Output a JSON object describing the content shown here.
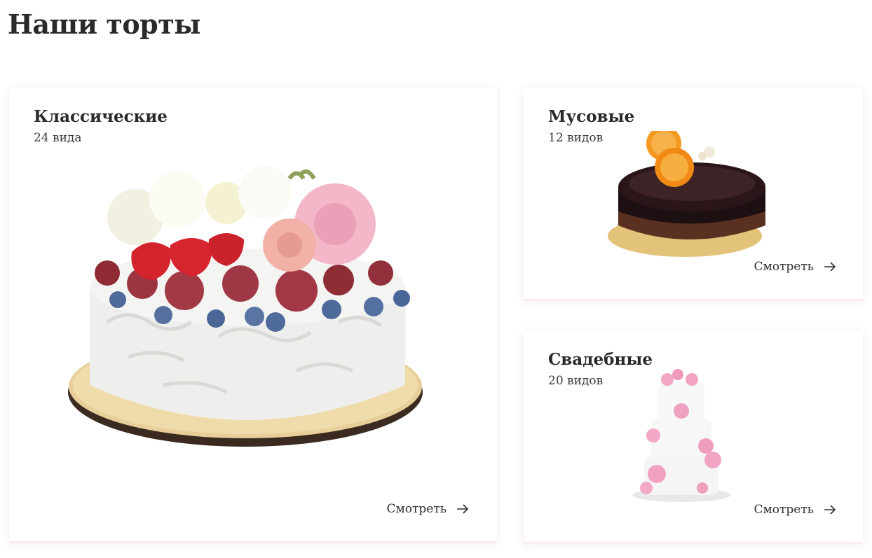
{
  "page": {
    "title": "Наши торты"
  },
  "cards": {
    "classic": {
      "title": "Классические",
      "count": "24 вида",
      "link_label": "Смотреть",
      "image_icon": "cream-cake-with-berries-and-flowers"
    },
    "mousse": {
      "title": "Мусовые",
      "count": "12 видов",
      "link_label": "Смотреть",
      "image_icon": "chocolate-glazed-mousse-cake"
    },
    "wedding": {
      "title": "Свадебные",
      "count": "20 видов",
      "link_label": "Смотреть",
      "image_icon": "three-tier-wedding-cake"
    }
  },
  "colors": {
    "text": "#2a2a2a",
    "card_shadow_accent": "#fbe8ec",
    "background": "#ffffff"
  }
}
